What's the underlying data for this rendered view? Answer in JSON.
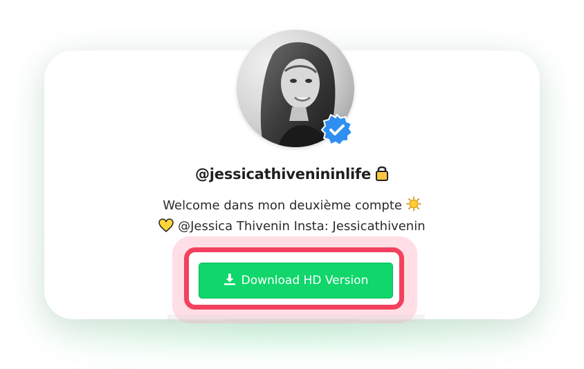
{
  "profile": {
    "username": "@jessicathivenininlife",
    "avatar_icon": "profile-photo",
    "verified_icon": "verified-badge-icon",
    "lock_icon": "lock-icon"
  },
  "bio": {
    "line1": "Welcome dans mon deuxième compte",
    "line1_emoji": "sun-emoji",
    "line2": "@Jessica Thivenin Insta: Jessicathivenin",
    "line2_emoji": "yellow-heart-emoji"
  },
  "actions": {
    "download_label": "Download HD Version",
    "download_icon": "download-icon"
  },
  "colors": {
    "accent_green": "#10d66b",
    "highlight_red": "#f2415e",
    "verified_blue": "#2e8ff0"
  }
}
